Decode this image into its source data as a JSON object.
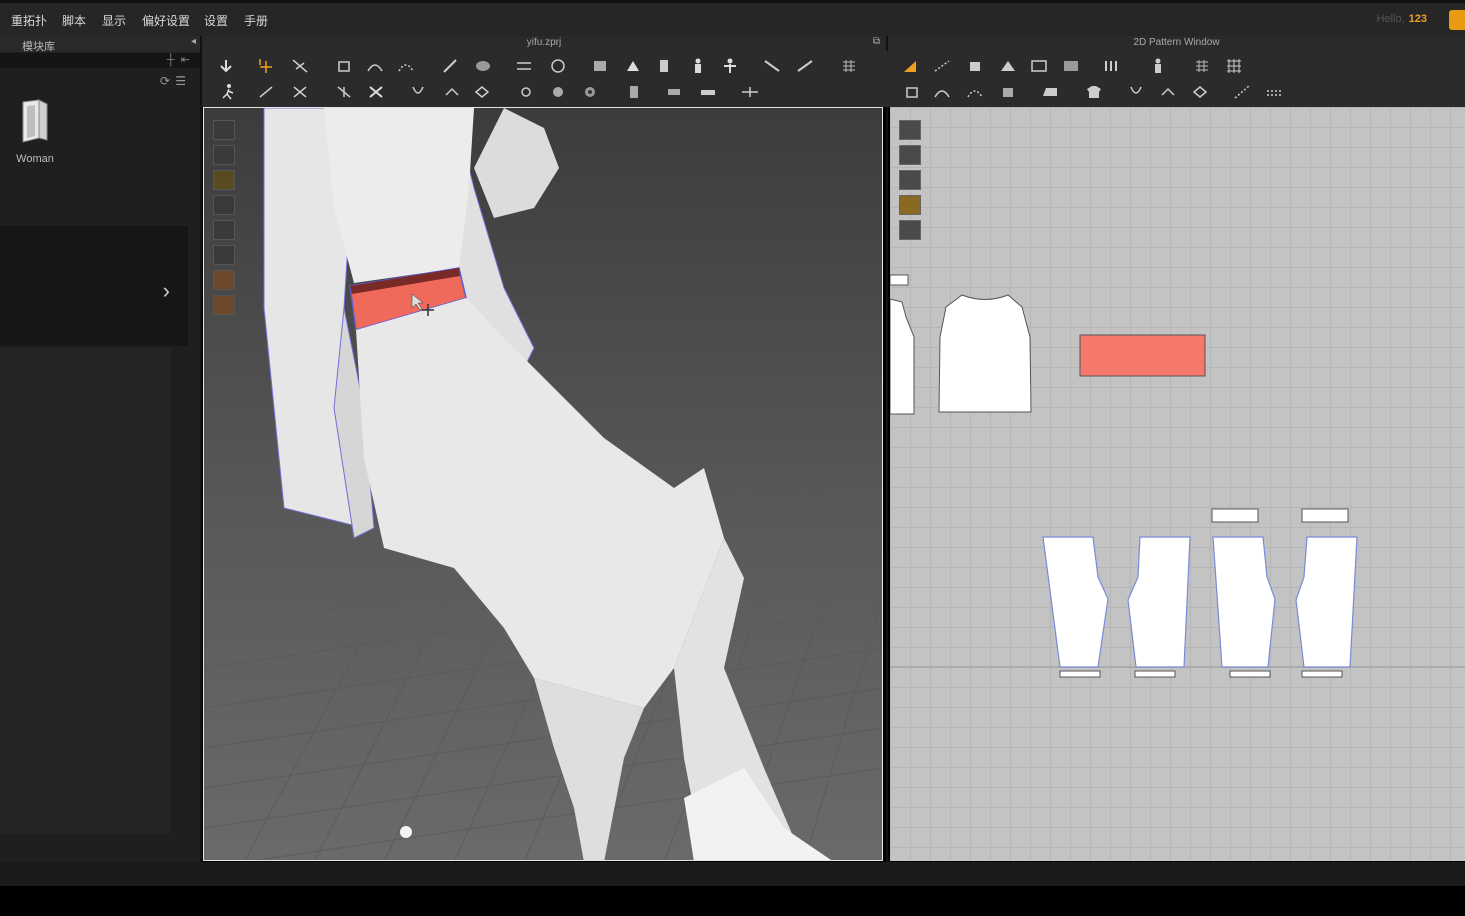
{
  "menu": {
    "items": [
      "重拓扑",
      "脚本",
      "显示",
      "偏好设置",
      "设置",
      "手册"
    ]
  },
  "account": {
    "greeting": "Hello,",
    "user": "123"
  },
  "library": {
    "title": "模块库",
    "item_label": "Woman"
  },
  "viewport3d": {
    "title": "yifu.zprj"
  },
  "pattern_window": {
    "title": "2D Pattern Window"
  },
  "colors": {
    "accent": "#f0a020",
    "selected_piece": "#f5786a",
    "pattern_bg": "#c3c3c3"
  },
  "icons": {
    "library_item": "folder-book-icon",
    "expand": "chevron-right-icon"
  }
}
